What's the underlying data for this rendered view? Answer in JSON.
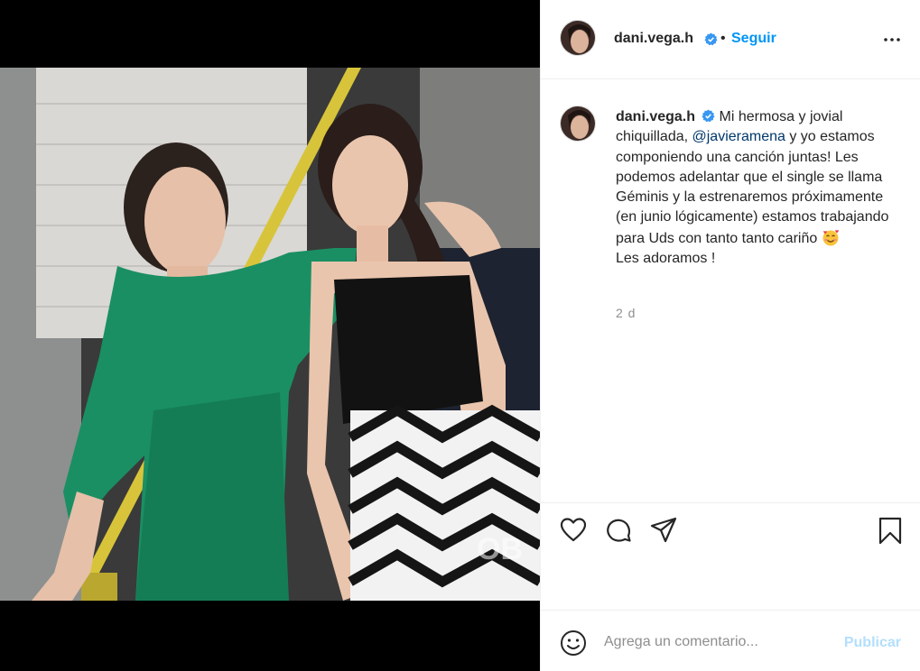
{
  "post": {
    "media_alt": "",
    "watermark": "OB"
  },
  "header": {
    "username": "dani.vega.h",
    "separator": "•",
    "follow_label": "Seguir",
    "more_icon": "more-horizontal-icon"
  },
  "caption": {
    "username": "dani.vega.h",
    "text_before": "Mi hermosa y jovial chiquillada, ",
    "mention": "@javieramena",
    "text_after": " y yo estamos componiendo una canción juntas! Les podemos adelantar que el single se llama Géminis y la estrenaremos próximamente (en junio lógicamente) estamos trabajando para Uds con tanto tanto cariño",
    "emoji": "smiling-face-with-hearts",
    "closing": "Les adoramos !",
    "time": "2 d"
  },
  "actions": {
    "like_icon": "heart-icon",
    "comment_icon": "comment-icon",
    "share_icon": "paper-plane-icon",
    "save_icon": "bookmark-icon"
  },
  "comment_box": {
    "placeholder": "Agrega un comentario...",
    "publish_label": "Publicar",
    "emoji_icon": "smiley-icon"
  },
  "colors": {
    "accent": "#0095f6",
    "mention": "#00376b",
    "publish_disabled": "#b2dffc",
    "muted": "#8e8e8e",
    "border": "#efefef"
  }
}
